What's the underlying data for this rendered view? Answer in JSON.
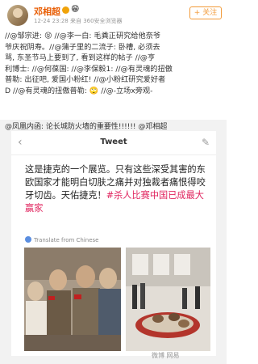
{
  "post": {
    "username": "邓相超",
    "badge_emoji": "😁",
    "meta": "12-24 23:28  来自 360安全浏览器",
    "follow_label": "+ 关注"
  },
  "repost": {
    "line1": "//@邹宗进: 😝 //@李一白: 毛粪正研究给他奈爷",
    "line2": "爷庆祝阴寿。//@蒲子里的二流子: 卧槽, 必须去",
    "line3": "骂, 东圣节马上要到了, 看到这样的帖子 //@亨",
    "line4": "利博士: //@何葆国: //@李保毅1: //@有灵魂的扭傲",
    "line5": "普勒: 出征吧, 爱国小粉红! //@小粉红研究爱好者",
    "line6": "D //@有灵魂的扭傲普勒: 🙄 //@-立场x旁观-"
  },
  "embed": {
    "line": "@凤凰内函: 论长城防火墙的重要性!!!!!! @邓相超"
  },
  "tweet": {
    "back_icon": "‹",
    "title": "Tweet",
    "edit_icon": "✎",
    "text_main": "这是捷克的一个展览。只有这些深受其害的东欧国家才能明白切肤之痛并对独裁者痛恨得咬牙切齿。天佑捷克！",
    "text_tag": "#杀人比赛中国已成最大赢家",
    "translate": "Translate from Chinese"
  },
  "watermark": "微博 网易"
}
